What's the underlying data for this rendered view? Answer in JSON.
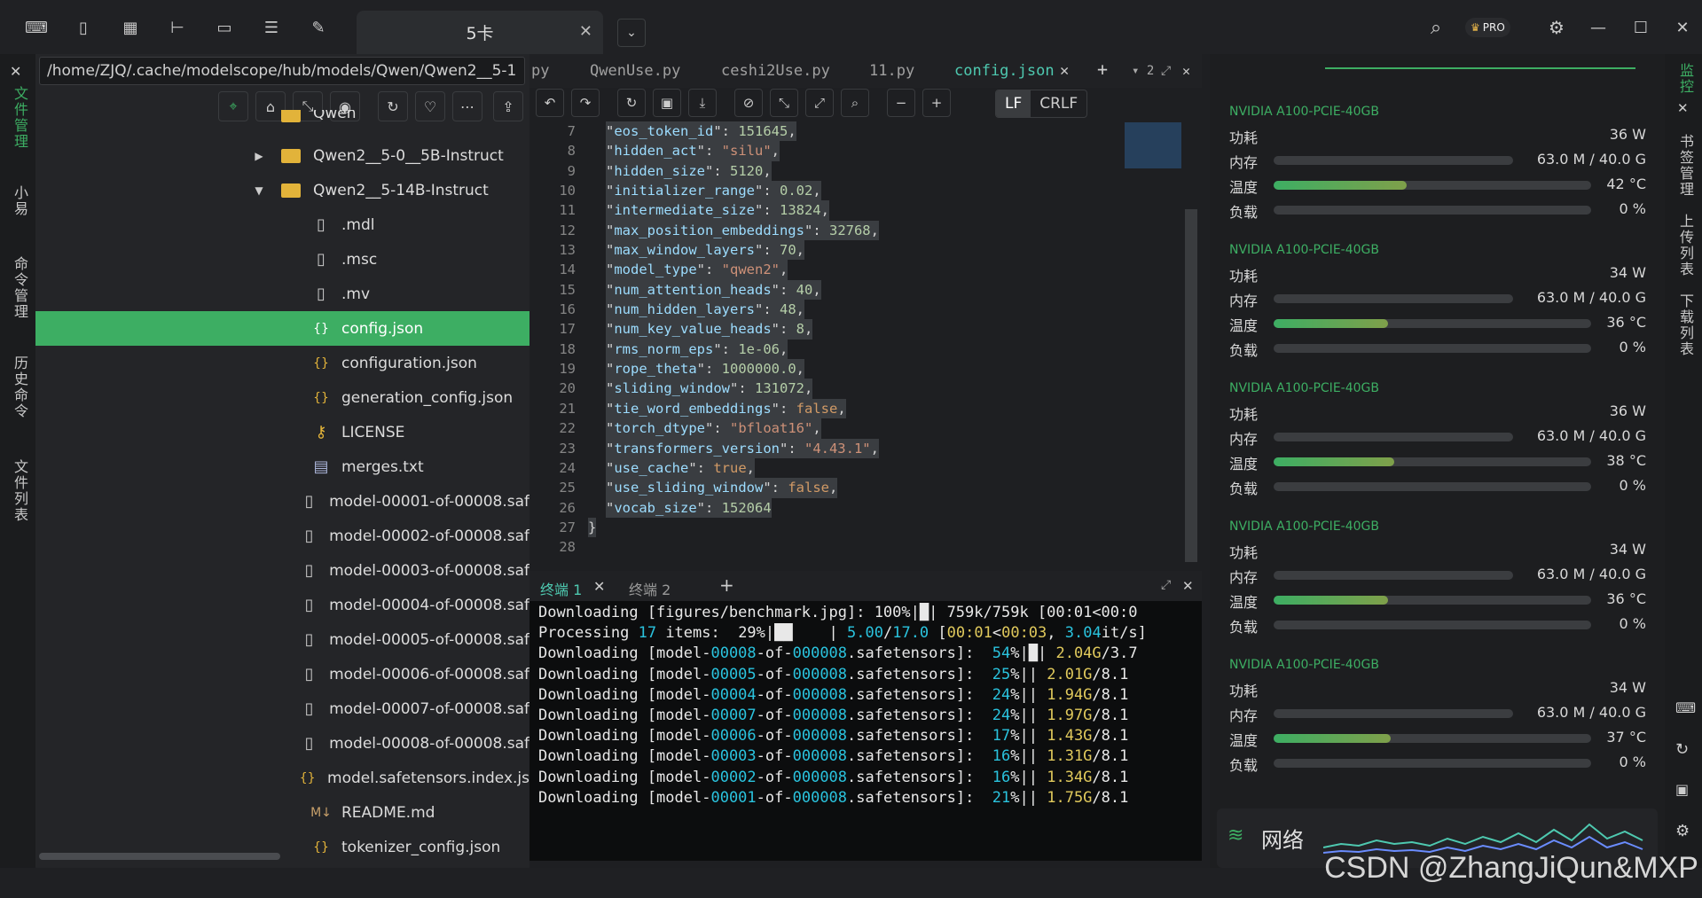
{
  "titlebar": {
    "tab_title": "5卡",
    "pro_badge": "PRO"
  },
  "leftbar": {
    "items": [
      "文件管理",
      "小易",
      "命令管理",
      "历史命令",
      "文件列表"
    ]
  },
  "explorer": {
    "path": "/home/ZJQ/.cache/modelscope/hub/models/Qwen/Qwen2__5-1",
    "rows": [
      {
        "label": "Qwen",
        "type": "folder"
      },
      {
        "label": "Qwen2__5-0__5B-Instruct",
        "type": "folder-collapsed"
      },
      {
        "label": "Qwen2__5-14B-Instruct",
        "type": "folder-open"
      },
      {
        "label": ".mdl",
        "type": "file"
      },
      {
        "label": ".msc",
        "type": "file"
      },
      {
        "label": ".mv",
        "type": "file"
      },
      {
        "label": "config.json",
        "type": "json",
        "selected": true
      },
      {
        "label": "configuration.json",
        "type": "json"
      },
      {
        "label": "generation_config.json",
        "type": "json"
      },
      {
        "label": "LICENSE",
        "type": "license"
      },
      {
        "label": "merges.txt",
        "type": "text"
      },
      {
        "label": "model-00001-of-00008.saf",
        "type": "file"
      },
      {
        "label": "model-00002-of-00008.saf",
        "type": "file"
      },
      {
        "label": "model-00003-of-00008.saf",
        "type": "file"
      },
      {
        "label": "model-00004-of-00008.saf",
        "type": "file"
      },
      {
        "label": "model-00005-of-00008.saf",
        "type": "file"
      },
      {
        "label": "model-00006-of-00008.saf",
        "type": "file"
      },
      {
        "label": "model-00007-of-00008.saf",
        "type": "file"
      },
      {
        "label": "model-00008-of-00008.saf",
        "type": "file"
      },
      {
        "label": "model.safetensors.index.js",
        "type": "json"
      },
      {
        "label": "README.md",
        "type": "markdown"
      },
      {
        "label": "tokenizer_config.json",
        "type": "json"
      }
    ]
  },
  "editor": {
    "tabs": [
      "py",
      "QwenUse.py",
      "ceshi2Use.py",
      "11.py",
      "config.json"
    ],
    "tab_count": "2",
    "lf_label": "LF",
    "crlf_label": "CRLF",
    "lines": [
      {
        "n": "7",
        "k": "eos_token_id",
        "v": "151645",
        "t": "n"
      },
      {
        "n": "8",
        "k": "hidden_act",
        "v": "\"silu\"",
        "t": "s"
      },
      {
        "n": "9",
        "k": "hidden_size",
        "v": "5120",
        "t": "n"
      },
      {
        "n": "10",
        "k": "initializer_range",
        "v": "0.02",
        "t": "n"
      },
      {
        "n": "11",
        "k": "intermediate_size",
        "v": "13824",
        "t": "n"
      },
      {
        "n": "12",
        "k": "max_position_embeddings",
        "v": "32768",
        "t": "n"
      },
      {
        "n": "13",
        "k": "max_window_layers",
        "v": "70",
        "t": "n"
      },
      {
        "n": "14",
        "k": "model_type",
        "v": "\"qwen2\"",
        "t": "s"
      },
      {
        "n": "15",
        "k": "num_attention_heads",
        "v": "40",
        "t": "n"
      },
      {
        "n": "16",
        "k": "num_hidden_layers",
        "v": "48",
        "t": "n"
      },
      {
        "n": "17",
        "k": "num_key_value_heads",
        "v": "8",
        "t": "n"
      },
      {
        "n": "18",
        "k": "rms_norm_eps",
        "v": "1e-06",
        "t": "n"
      },
      {
        "n": "19",
        "k": "rope_theta",
        "v": "1000000.0",
        "t": "n"
      },
      {
        "n": "20",
        "k": "sliding_window",
        "v": "131072",
        "t": "n"
      },
      {
        "n": "21",
        "k": "tie_word_embeddings",
        "v": "false",
        "t": "b"
      },
      {
        "n": "22",
        "k": "torch_dtype",
        "v": "\"bfloat16\"",
        "t": "s"
      },
      {
        "n": "23",
        "k": "transformers_version",
        "v": "\"4.43.1\"",
        "t": "s"
      },
      {
        "n": "24",
        "k": "use_cache",
        "v": "true",
        "t": "b"
      },
      {
        "n": "25",
        "k": "use_sliding_window",
        "v": "false",
        "t": "b"
      },
      {
        "n": "26",
        "k": "vocab_size",
        "v": "152064",
        "t": "n",
        "last": true
      },
      {
        "n": "27",
        "raw": "}"
      },
      {
        "n": "28",
        "raw": ""
      }
    ]
  },
  "terminal": {
    "tabs": [
      "终端 1",
      "终端 2"
    ],
    "lines": [
      [
        [
          "Downloading [figures/benchmark.jpg]: 100%|█| 759k/759k [00:01<00:0",
          ""
        ]
      ],
      [
        [
          "Processing ",
          ""
        ],
        [
          "17",
          "tc"
        ],
        [
          " items:  29%|██    | ",
          ""
        ],
        [
          "5.00",
          "tc"
        ],
        [
          "/",
          ""
        ],
        [
          "17.0",
          "tc"
        ],
        [
          " [",
          ""
        ],
        [
          "00:01",
          "ty"
        ],
        [
          "<",
          ""
        ],
        [
          "00:03",
          "ty"
        ],
        [
          ", ",
          ""
        ],
        [
          "3.04",
          "tc"
        ],
        [
          "it/s]",
          ""
        ]
      ],
      [
        [
          "Downloading [model-",
          ""
        ],
        [
          "00008",
          "tc"
        ],
        [
          "-of-",
          ""
        ],
        [
          "000008",
          "tc"
        ],
        [
          ".safetensors]:  ",
          ""
        ],
        [
          "54",
          "tc"
        ],
        [
          "%|█| ",
          ""
        ],
        [
          "2.04G",
          "ty"
        ],
        [
          "/3.7",
          ""
        ]
      ],
      [
        [
          "Downloading [model-",
          ""
        ],
        [
          "00005",
          "tc"
        ],
        [
          "-of-",
          ""
        ],
        [
          "000008",
          "tc"
        ],
        [
          ".safetensors]:  ",
          ""
        ],
        [
          "25",
          "tc"
        ],
        [
          "%|| ",
          ""
        ],
        [
          "2.01G",
          "ty"
        ],
        [
          "/8.1",
          ""
        ]
      ],
      [
        [
          "Downloading [model-",
          ""
        ],
        [
          "00004",
          "tc"
        ],
        [
          "-of-",
          ""
        ],
        [
          "000008",
          "tc"
        ],
        [
          ".safetensors]:  ",
          ""
        ],
        [
          "24",
          "tc"
        ],
        [
          "%|| ",
          ""
        ],
        [
          "1.94G",
          "ty"
        ],
        [
          "/8.1",
          ""
        ]
      ],
      [
        [
          "Downloading [model-",
          ""
        ],
        [
          "00007",
          "tc"
        ],
        [
          "-of-",
          ""
        ],
        [
          "000008",
          "tc"
        ],
        [
          ".safetensors]:  ",
          ""
        ],
        [
          "24",
          "tc"
        ],
        [
          "%|| ",
          ""
        ],
        [
          "1.97G",
          "ty"
        ],
        [
          "/8.1",
          ""
        ]
      ],
      [
        [
          "Downloading [model-",
          ""
        ],
        [
          "00006",
          "tc"
        ],
        [
          "-of-",
          ""
        ],
        [
          "000008",
          "tc"
        ],
        [
          ".safetensors]:  ",
          ""
        ],
        [
          "17",
          "tc"
        ],
        [
          "%|| ",
          ""
        ],
        [
          "1.43G",
          "ty"
        ],
        [
          "/8.1",
          ""
        ]
      ],
      [
        [
          "Downloading [model-",
          ""
        ],
        [
          "00003",
          "tc"
        ],
        [
          "-of-",
          ""
        ],
        [
          "000008",
          "tc"
        ],
        [
          ".safetensors]:  ",
          ""
        ],
        [
          "16",
          "tc"
        ],
        [
          "%|| ",
          ""
        ],
        [
          "1.31G",
          "ty"
        ],
        [
          "/8.1",
          ""
        ]
      ],
      [
        [
          "Downloading [model-",
          ""
        ],
        [
          "00002",
          "tc"
        ],
        [
          "-of-",
          ""
        ],
        [
          "000008",
          "tc"
        ],
        [
          ".safetensors]:  ",
          ""
        ],
        [
          "16",
          "tc"
        ],
        [
          "%|| ",
          ""
        ],
        [
          "1.34G",
          "ty"
        ],
        [
          "/8.1",
          ""
        ]
      ],
      [
        [
          "Downloading [model-",
          ""
        ],
        [
          "00001",
          "tc"
        ],
        [
          "-of-",
          ""
        ],
        [
          "000008",
          "tc"
        ],
        [
          ".safetensors]:  ",
          ""
        ],
        [
          "21",
          "tc"
        ],
        [
          "%|| ",
          ""
        ],
        [
          "1.75G",
          "ty"
        ],
        [
          "/8.1",
          ""
        ]
      ]
    ]
  },
  "monitor": {
    "labels": {
      "power": "功耗",
      "memory": "内存",
      "temp": "温度",
      "load": "负载"
    },
    "gpus": [
      {
        "name": "NVIDIA A100-PCIE-40GB",
        "power": "36 W",
        "memory": "63.0 M / 40.0 G",
        "mem_frac": 0.0015,
        "temp": "42 °C",
        "temp_frac": 0.42,
        "load": "0 %",
        "load_frac": 0
      },
      {
        "name": "NVIDIA A100-PCIE-40GB",
        "power": "34 W",
        "memory": "63.0 M / 40.0 G",
        "mem_frac": 0.0015,
        "temp": "36 °C",
        "temp_frac": 0.36,
        "load": "0 %",
        "load_frac": 0
      },
      {
        "name": "NVIDIA A100-PCIE-40GB",
        "power": "36 W",
        "memory": "63.0 M / 40.0 G",
        "mem_frac": 0.0015,
        "temp": "38 °C",
        "temp_frac": 0.38,
        "load": "0 %",
        "load_frac": 0
      },
      {
        "name": "NVIDIA A100-PCIE-40GB",
        "power": "34 W",
        "memory": "63.0 M / 40.0 G",
        "mem_frac": 0.0015,
        "temp": "36 °C",
        "temp_frac": 0.36,
        "load": "0 %",
        "load_frac": 0
      },
      {
        "name": "NVIDIA A100-PCIE-40GB",
        "power": "34 W",
        "memory": "63.0 M / 40.0 G",
        "mem_frac": 0.0015,
        "temp": "37 °C",
        "temp_frac": 0.37,
        "load": "0 %",
        "load_frac": 0
      }
    ],
    "network_label": "网络"
  },
  "rightbar": {
    "items": [
      "监控",
      "书签管理",
      "上传列表",
      "下载列表"
    ]
  },
  "watermark": "CSDN @ZhangJiQun&MXP",
  "colors": {
    "accent": "#3dae63",
    "code_key": "#9cdcfe",
    "code_string": "#ce9178",
    "code_number": "#b5cea8"
  }
}
